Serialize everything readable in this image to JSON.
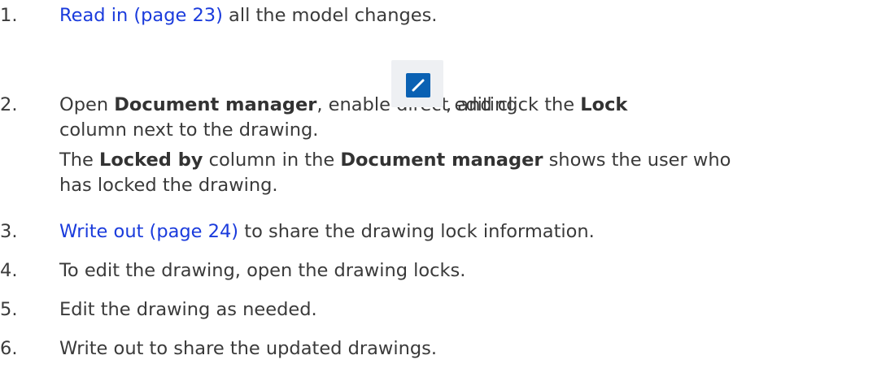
{
  "steps": [
    {
      "num": "1.",
      "link": "Read in (page 23)",
      "rest": " all the model changes."
    },
    {
      "num": "2.",
      "open": "Open ",
      "doc_manager": "Document manager",
      "mid": ", enable direct editing ",
      "after_icon": ", and click the ",
      "lock": "Lock",
      "line2": "column next to the drawing.",
      "icon": "pencil-edit-icon",
      "note_the": "The ",
      "locked_by": "Locked by",
      "note_mid": " column in the ",
      "note_doc_manager": "Document manager",
      "note_rest": " shows the user who has locked the drawing."
    },
    {
      "num": "3.",
      "link": "Write out (page 24)",
      "rest": " to share the drawing lock information."
    },
    {
      "num": "4.",
      "text": "To edit the drawing, open the drawing locks."
    },
    {
      "num": "5.",
      "text": "Edit the drawing as needed."
    },
    {
      "num": "6.",
      "text": "Write out to share the updated drawings."
    }
  ],
  "colors": {
    "text": "#3a3a3a",
    "link": "#1a3bdc",
    "icon_bg": "#eef0f3",
    "icon_fill": "#0a61b3"
  }
}
